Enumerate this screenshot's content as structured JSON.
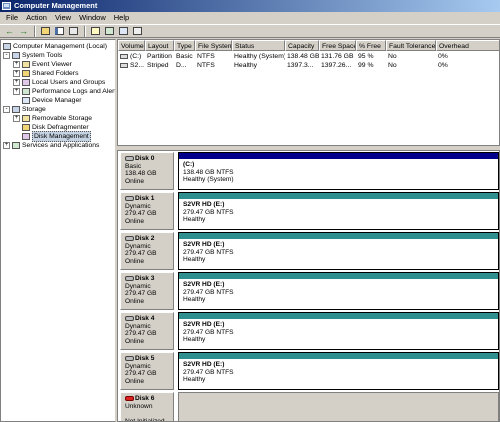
{
  "window": {
    "title": "Computer Management"
  },
  "menu": [
    "File",
    "Action",
    "View",
    "Window",
    "Help"
  ],
  "tree": {
    "root": "Computer Management (Local)",
    "items": [
      {
        "label": "System Tools",
        "level": 1,
        "expander": "-"
      },
      {
        "label": "Event Viewer",
        "level": 2,
        "expander": "+"
      },
      {
        "label": "Shared Folders",
        "level": 2,
        "expander": "+"
      },
      {
        "label": "Local Users and Groups",
        "level": 2,
        "expander": "+"
      },
      {
        "label": "Performance Logs and Alerts",
        "level": 2,
        "expander": "+"
      },
      {
        "label": "Device Manager",
        "level": 2,
        "expander": ""
      },
      {
        "label": "Storage",
        "level": 1,
        "expander": "-"
      },
      {
        "label": "Removable Storage",
        "level": 2,
        "expander": "+"
      },
      {
        "label": "Disk Defragmenter",
        "level": 2,
        "expander": ""
      },
      {
        "label": "Disk Management",
        "level": 2,
        "expander": "",
        "selected": true
      },
      {
        "label": "Services and Applications",
        "level": 1,
        "expander": "+"
      }
    ]
  },
  "volume_list": {
    "columns": [
      "Volume",
      "Layout",
      "Type",
      "File System",
      "Status",
      "Capacity",
      "Free Space",
      "% Free",
      "Fault Tolerance",
      "Overhead"
    ],
    "rows": [
      [
        "(C:)",
        "Partition",
        "Basic",
        "NTFS",
        "Healthy (System)",
        "138.48 GB",
        "131.76 GB",
        "95 %",
        "No",
        "0%"
      ],
      [
        "S2...",
        "Striped",
        "D...",
        "NTFS",
        "Healthy",
        "1397.3...",
        "1397.26...",
        "99 %",
        "No",
        "0%"
      ]
    ]
  },
  "disks": [
    {
      "name": "Disk 0",
      "type": "Basic",
      "size": "138.48 GB",
      "status": "Online",
      "icon": "disk-icon",
      "volume": {
        "name": "(C:)",
        "size": "138.48 GB NTFS",
        "status": "Healthy (System)",
        "style": "primary"
      }
    },
    {
      "name": "Disk 1",
      "type": "Dynamic",
      "size": "279.47 GB",
      "status": "Online",
      "icon": "disk-icon",
      "volume": {
        "name": "S2VR HD  (E:)",
        "size": "279.47 GB NTFS",
        "status": "Healthy",
        "style": "striped"
      }
    },
    {
      "name": "Disk 2",
      "type": "Dynamic",
      "size": "279.47 GB",
      "status": "Online",
      "icon": "disk-icon",
      "volume": {
        "name": "S2VR HD  (E:)",
        "size": "279.47 GB NTFS",
        "status": "Healthy",
        "style": "striped"
      }
    },
    {
      "name": "Disk 3",
      "type": "Dynamic",
      "size": "279.47 GB",
      "status": "Online",
      "icon": "disk-icon",
      "volume": {
        "name": "S2VR HD  (E:)",
        "size": "279.47 GB NTFS",
        "status": "Healthy",
        "style": "striped"
      }
    },
    {
      "name": "Disk 4",
      "type": "Dynamic",
      "size": "279.47 GB",
      "status": "Online",
      "icon": "disk-icon",
      "volume": {
        "name": "S2VR HD  (E:)",
        "size": "279.47 GB NTFS",
        "status": "Healthy",
        "style": "striped"
      }
    },
    {
      "name": "Disk 5",
      "type": "Dynamic",
      "size": "279.47 GB",
      "status": "Online",
      "icon": "disk-icon",
      "volume": {
        "name": "S2VR HD  (E:)",
        "size": "279.47 GB NTFS",
        "status": "Healthy",
        "style": "striped"
      }
    },
    {
      "name": "Disk 6",
      "type": "Unknown",
      "size": "",
      "status": "Not Initialized",
      "icon": "disk-error-icon",
      "volume": null
    }
  ],
  "colors": {
    "primary_partition": "#00008b",
    "striped_volume": "#2f8f8f",
    "title_bar": "#0a246a"
  },
  "toolbar_icons": [
    "back-arrow-icon",
    "forward-arrow-icon",
    "up-folder-icon",
    "show-hide-tree-icon",
    "properties-icon",
    "help-icon",
    "refresh-icon",
    "export-icon",
    "view-icon"
  ]
}
